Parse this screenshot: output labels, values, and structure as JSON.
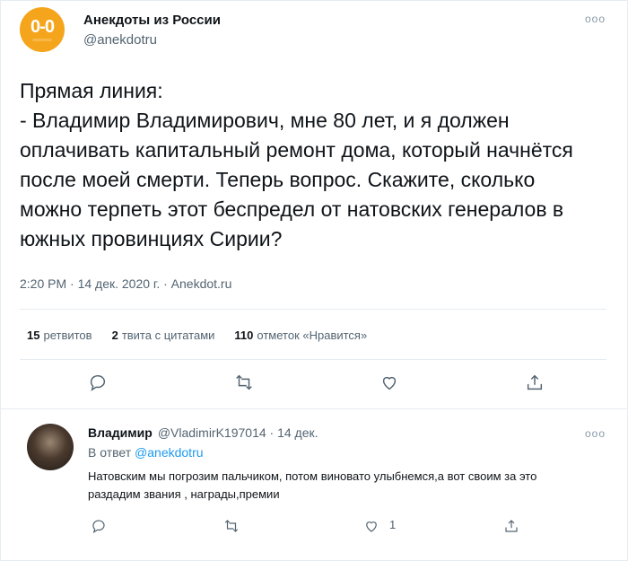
{
  "tweet": {
    "account_name": "Анекдоты из России",
    "handle": "@anekdotru",
    "avatar_text": "0-0",
    "more": "ooo",
    "text": "Прямая линия:\n- Владимир Владимирович, мне 80 лет, и я должен оплачивать капитальный ремонт дома, который начнётся после моей смерти. Теперь вопрос. Скажите, сколько можно терпеть этот беспредел от натовских генералов в южных провинциях Сирии?",
    "timestamp": "2:20 PM · 14 дек. 2020 г. · Anekdot.ru",
    "stats": {
      "retweets_count": "15",
      "retweets_label": "ретвитов",
      "quotes_count": "2",
      "quotes_label": "твита с цитатами",
      "likes_count": "110",
      "likes_label": "отметок «Нравится»"
    }
  },
  "reply": {
    "name": "Владимир",
    "handle_date": "@VladimirK197014 · 14 дек.",
    "reply_to_label": "В ответ",
    "reply_to_handle": "@anekdotru",
    "text": "Натовским мы погрозим пальчиком, потом виновато улыбнемся,а вот своим за это раздадим звания , награды,премии",
    "like_count": "1",
    "more": "ooo"
  },
  "icons": {
    "reply": "reply-icon",
    "retweet": "retweet-icon",
    "like": "heart-icon",
    "share": "share-icon"
  },
  "colors": {
    "text": "#0f1419",
    "secondary": "#536471",
    "link": "#1d9bf0",
    "avatar_bg": "#f5a51c",
    "divider": "#e6ecf0"
  }
}
